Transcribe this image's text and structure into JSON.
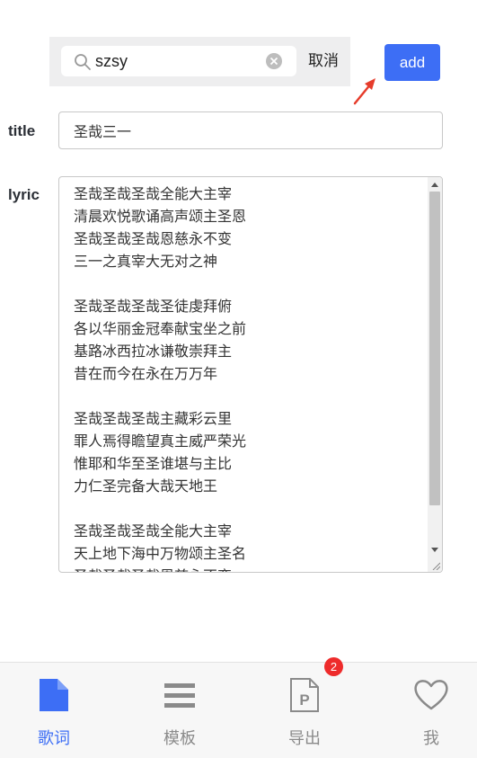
{
  "search": {
    "value": "szsy",
    "cancel_label": "取消"
  },
  "toolbar": {
    "add_label": "add"
  },
  "form": {
    "title_label": "title",
    "title_value": "圣哉三一",
    "lyric_label": "lyric",
    "lyric_lines": [
      "圣哉圣哉圣哉全能大主宰",
      "清晨欢悦歌诵高声颂主圣恩",
      "圣哉圣哉圣哉恩慈永不变",
      "三一之真宰大无对之神",
      "",
      "圣哉圣哉圣哉圣徒虔拜俯",
      "各以华丽金冠奉献宝坐之前",
      "基路冰西拉冰谦敬崇拜主",
      "昔在而今在永在万万年",
      "",
      "圣哉圣哉圣哉主藏彩云里",
      "罪人焉得瞻望真主威严荣光",
      "惟耶和华至圣谁堪与主比",
      "力仁圣完备大哉天地王",
      "",
      "圣哉圣哉圣哉全能大主宰",
      "天上地下海中万物颂主圣名",
      "圣哉圣哉圣哉恩慈永不变"
    ]
  },
  "tabbar": {
    "tabs": [
      {
        "label": "歌词",
        "icon": "document-icon",
        "active": true
      },
      {
        "label": "模板",
        "icon": "list-icon",
        "active": false
      },
      {
        "label": "导出",
        "icon": "export-p-icon",
        "active": false,
        "badge": "2"
      },
      {
        "label": "我",
        "icon": "heart-icon",
        "active": false
      }
    ]
  },
  "colors": {
    "accent": "#3d6ef5",
    "badge": "#ee2b2b",
    "arrow": "#e63c2b"
  }
}
